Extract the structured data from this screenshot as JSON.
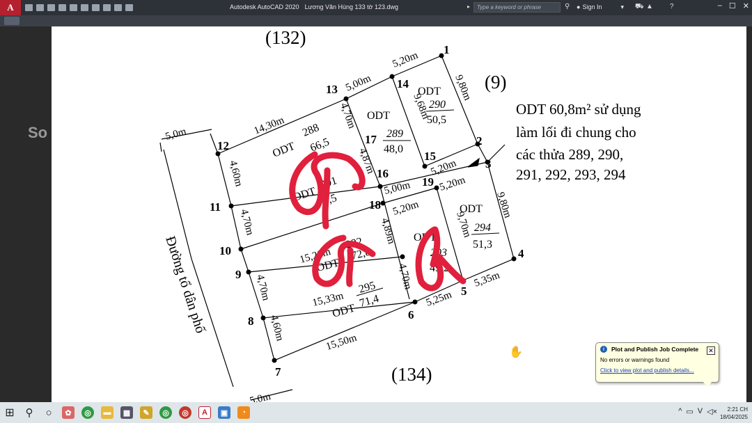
{
  "titlebar": {
    "app_name": "Autodesk AutoCAD 2020",
    "document": "Lương Văn Hùng 133 tờ 123.dwg",
    "search_placeholder": "Type a keyword or phrase",
    "sign_in": "Sign In",
    "logo_letter": "A",
    "window_minimize": "–",
    "window_restore": "☐",
    "window_close": "✕"
  },
  "drawing": {
    "parcel_labels": {
      "top": "(132)",
      "right": "(9)",
      "bottom": "(134)"
    },
    "road_label": "Đường tổ dân phố",
    "note_lines": [
      "ODT 60,8m² sử dụng",
      "làm lối đi chung cho",
      "các thửa 289, 290,",
      "291, 292, 293, 294"
    ],
    "points": [
      "1",
      "2",
      "3",
      "4",
      "5",
      "6",
      "7",
      "8",
      "9",
      "10",
      "11",
      "12",
      "13",
      "14",
      "15",
      "16",
      "17",
      "18",
      "19"
    ],
    "dimensions": {
      "d_13_14": "5,00m",
      "d_14_1": "5,20m",
      "d_1_2": "9,80m",
      "d_14_15": "9,68m",
      "d_13_17": "4,70m",
      "d_12_13": "14,30m",
      "d_top_left": "5,0m",
      "d_12_11": "4,60m",
      "d_17_16": "4,87m",
      "d_15_3": "5,20m",
      "d_16_19": "5,00m",
      "d_19_4": "5,20m",
      "d_3_4": "9,80m",
      "d_11_10": "4,70m",
      "d_18_19": "5,20m",
      "d_19_5": "9,70m",
      "d_16_row": "4,89m",
      "d_10_row": "15,20m",
      "d_9_8": "4,70m",
      "d_9_row": "15,33m",
      "d_20_6": "4,70m",
      "d_6_5": "5,25m",
      "d_5_4": "5,35m",
      "d_8_7": "4,60m",
      "d_7_6": "15,50m",
      "d_bottom_left": "5,0m"
    },
    "parcels": [
      {
        "code": "ODT",
        "num": "290",
        "area": "50,5"
      },
      {
        "code": "ODT",
        "num": "289",
        "area": "48,0"
      },
      {
        "code": "ODT",
        "num": "288",
        "area": "66,5"
      },
      {
        "code": "ODT",
        "num": "291",
        "area": "70,5"
      },
      {
        "code": "ODT",
        "num": "294",
        "area": "51,3"
      },
      {
        "code": "ODT",
        "num": "292",
        "area": "72,8"
      },
      {
        "code": "ODT",
        "num": "293",
        "area": "49,2"
      },
      {
        "code": "ODT",
        "num": "295",
        "area": "71,4"
      }
    ],
    "markings": {
      "cross_color": "#e0203c"
    }
  },
  "notification": {
    "title": "Plot and Publish Job Complete",
    "message": "No errors or warnings found",
    "link": "Click to view plot and publish details..."
  },
  "taskbar": {
    "clock_time": "2:21 CH",
    "clock_date": "18/04/2025"
  }
}
